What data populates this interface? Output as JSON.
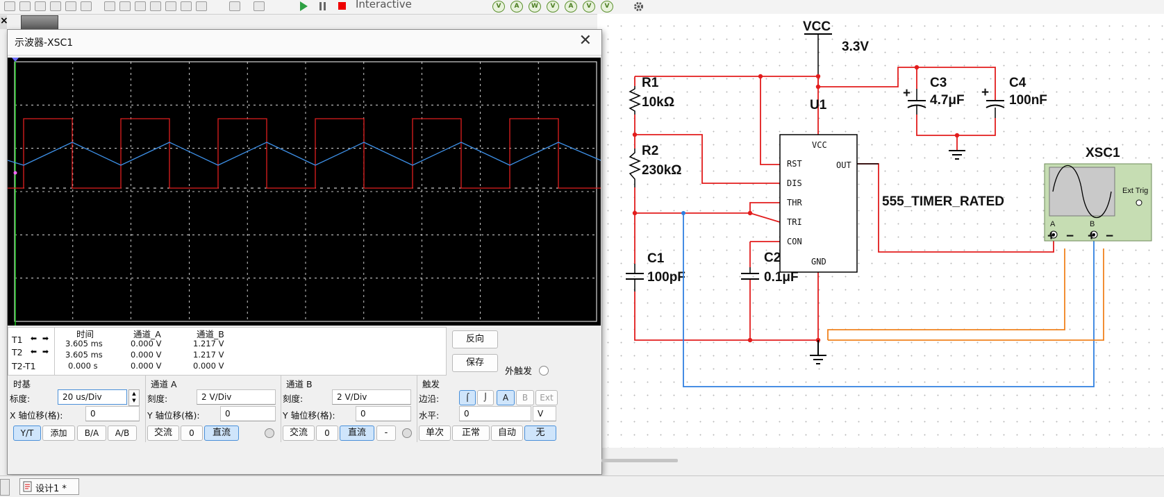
{
  "toolbar": {
    "mode_label": "Interactive",
    "instrument_icons": [
      "V",
      "A",
      "W",
      "V",
      "A",
      "V",
      "V",
      "gear-icon"
    ]
  },
  "scope": {
    "title": "示波器-XSC1",
    "readout": {
      "col_time": "时间",
      "col_a": "通道_A",
      "col_b": "通道_B",
      "rows": [
        {
          "label": "T1",
          "time": "3.605 ms",
          "a": "0.000 V",
          "b": "1.217 V"
        },
        {
          "label": "T2",
          "time": "3.605 ms",
          "a": "0.000 V",
          "b": "1.217 V"
        },
        {
          "label": "T2-T1",
          "time": "0.000 s",
          "a": "0.000 V",
          "b": "0.000 V"
        }
      ]
    },
    "buttons": {
      "reverse": "反向",
      "save": "保存",
      "external_trigger": "外触发"
    },
    "timebase": {
      "section": "时基",
      "scale_label": "标度:",
      "scale_value": "20 us/Div",
      "xpos_label": "X 轴位移(格):",
      "xpos_value": "0",
      "modes": [
        "Y/T",
        "添加",
        "B/A",
        "A/B"
      ]
    },
    "channel_a": {
      "section": "通道 A",
      "scale_label": "刻度:",
      "scale_value": "2  V/Div",
      "ypos_label": "Y 轴位移(格):",
      "ypos_value": "0",
      "coupling": [
        "交流",
        "0",
        "直流"
      ]
    },
    "channel_b": {
      "section": "通道 B",
      "scale_label": "刻度:",
      "scale_value": "2  V/Div",
      "ypos_label": "Y 轴位移(格):",
      "ypos_value": "0",
      "coupling": [
        "交流",
        "0",
        "直流",
        "-"
      ]
    },
    "trigger": {
      "section": "触发",
      "edge_label": "边沿:",
      "level_label": "水平:",
      "level_value": "0",
      "level_unit": "V",
      "sources": [
        "A",
        "B",
        "Ext"
      ],
      "modes": [
        "单次",
        "正常",
        "自动",
        "无"
      ]
    },
    "colors": {
      "channel_a": "#e01f1f",
      "channel_b": "#3d8fe6",
      "grid": "#ffffff"
    }
  },
  "schematic": {
    "vcc_label": "VCC",
    "vcc_value": "3.3V",
    "u1_label": "U1",
    "ic_name": "555_TIMER_RATED",
    "pins": {
      "vcc": "VCC",
      "rst": "RST",
      "dis": "DIS",
      "thr": "THR",
      "tri": "TRI",
      "con": "CON",
      "gnd": "GND",
      "out": "OUT"
    },
    "r1_label": "R1",
    "r1_value": "10kΩ",
    "r2_label": "R2",
    "r2_value": "230kΩ",
    "c1_label": "C1",
    "c1_value": "100pF",
    "c2_label": "C2",
    "c2_value": "0.1μF",
    "c3_label": "C3",
    "c3_value": "4.7μF",
    "c4_label": "C4",
    "c4_value": "100nF",
    "xsc_label": "XSC1",
    "ext_trig": "Ext Trig",
    "ch_a": "A",
    "ch_b": "B",
    "plus": "+",
    "minus": "−"
  },
  "taskbar": {
    "design_tab": "设计1 *"
  }
}
